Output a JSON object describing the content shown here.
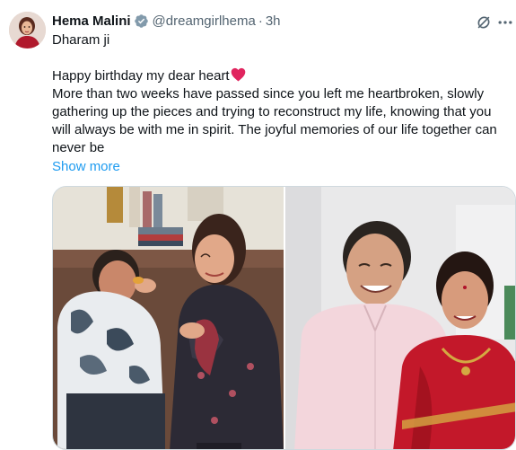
{
  "author": {
    "name": "Hema Malini",
    "handle": "@dreamgirlhema",
    "separator": "·",
    "time": "3h"
  },
  "tweet": {
    "lines": [
      "Dharam ji",
      "",
      "Happy birthday my dear heart",
      "More than two weeks have passed since you left me heartbroken, slowly",
      "gathering up the pieces and trying to reconstruct my life, knowing that you",
      "will always be with me in spirit. The joyful memories of our life together can",
      "never be"
    ],
    "emoji": "red-heart",
    "show_more": "Show more"
  },
  "media": {
    "photos": [
      {
        "subject": "couple-sharing-sweet-photo"
      },
      {
        "subject": "couple-portrait-photo"
      }
    ]
  },
  "icons": {
    "verified": "verified-badge-icon",
    "grok": "grok-icon",
    "more": "more-options-icon"
  },
  "colors": {
    "text": "#0f1419",
    "secondary": "#536471",
    "link": "#1d9bf0",
    "verified": "#829aab",
    "heart": "#e0245e"
  }
}
